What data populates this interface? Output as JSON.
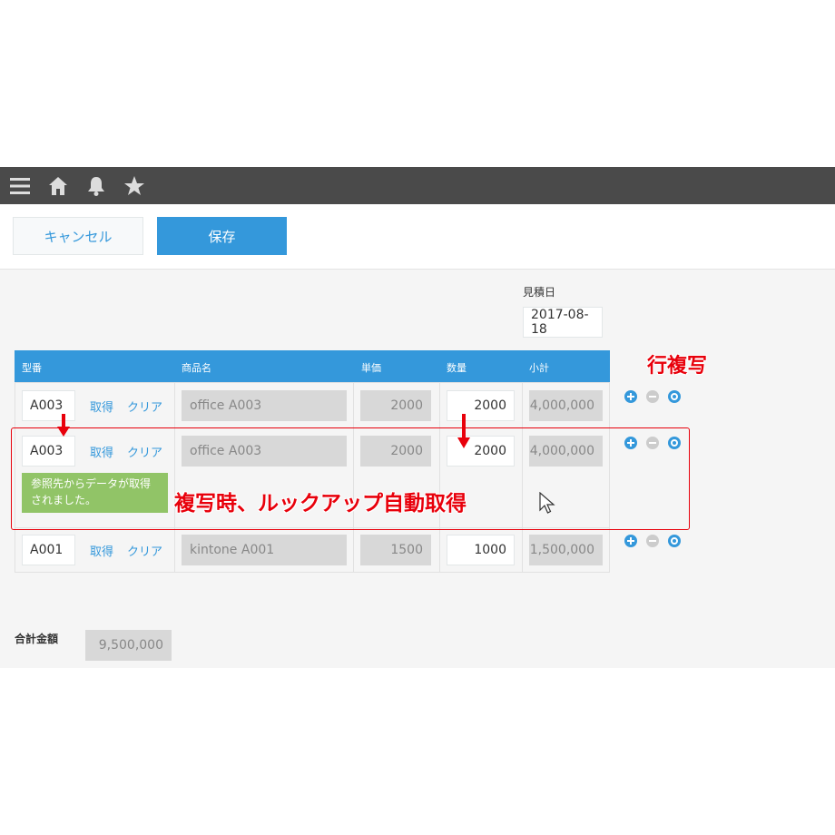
{
  "header": {
    "icons": [
      "menu-icon",
      "home-icon",
      "bell-icon",
      "star-icon"
    ]
  },
  "actions": {
    "cancel_label": "キャンセル",
    "save_label": "保存"
  },
  "form": {
    "date_label": "見積日",
    "date_value": "2017-08-18",
    "total_label": "合計金額",
    "total_value": "9,500,000"
  },
  "table": {
    "headers": [
      "型番",
      "商品名",
      "単価",
      "数量",
      "小計"
    ],
    "fetch_label": "取得",
    "clear_label": "クリア",
    "rows": [
      {
        "code": "A003",
        "name": "office A003",
        "price": "2000",
        "qty": "2000",
        "subtotal": "4,000,000"
      },
      {
        "code": "A003",
        "name": "office A003",
        "price": "2000",
        "qty": "2000",
        "subtotal": "4,000,000"
      },
      {
        "code": "A001",
        "name": "kintone A001",
        "price": "1500",
        "qty": "1000",
        "subtotal": "1,500,000"
      }
    ],
    "notice": "参照先からデータが取得されました。"
  },
  "annotations": {
    "row_copy": "行複写",
    "auto_lookup": "複写時、ルックアップ自動取得"
  },
  "colors": {
    "accent": "#3498db",
    "annotation_red": "#e8000b",
    "notice_green": "#91c467"
  }
}
